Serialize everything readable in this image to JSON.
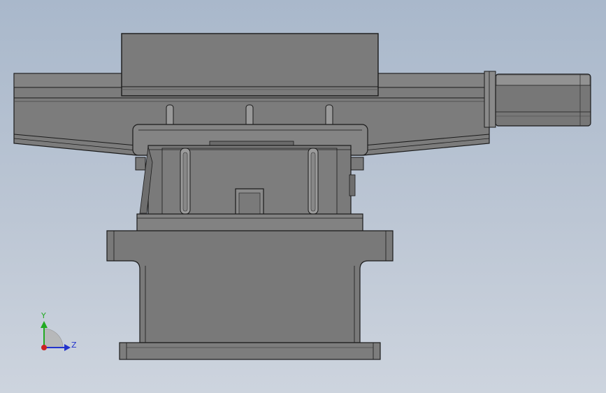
{
  "viewport": {
    "background_top": "#a9b8cb",
    "background_bottom": "#cdd4de",
    "model_fill": "#7a7a7a",
    "model_shadow": "#686868",
    "model_highlight": "#9a9a9a",
    "edge_color": "#1a1a1a"
  },
  "triad": {
    "y_label": "Y",
    "z_label": "Z",
    "y_color": "#22aa22",
    "z_color": "#2233cc",
    "x_color": "#cc2222"
  }
}
